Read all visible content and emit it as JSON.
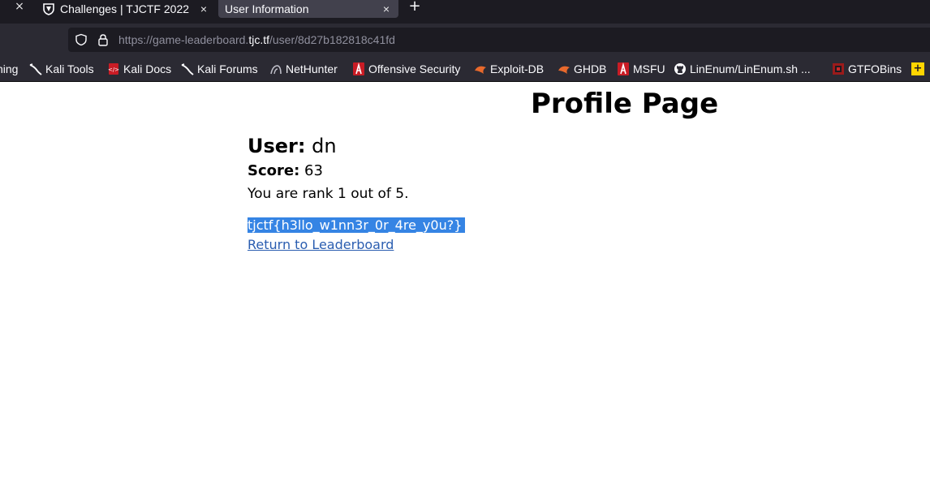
{
  "browser": {
    "tabs": [
      {
        "title": "Challenges | TJCTF 2022",
        "active": false,
        "icon": "tjctf-shield-icon"
      },
      {
        "title": "User Information",
        "active": true,
        "icon": ""
      }
    ],
    "close_symbol": "×",
    "new_tab_symbol": "+",
    "url": {
      "prefix": "https://game-leaderboard.",
      "host": "tjc.tf",
      "path": "/user/8d27b182818c41fd"
    },
    "bookmarks": [
      {
        "label": "ning",
        "icon": ""
      },
      {
        "label": "Kali Tools",
        "icon": "kali-dragon-icon"
      },
      {
        "label": "Kali Docs",
        "icon": "kali-docs-icon"
      },
      {
        "label": "Kali Forums",
        "icon": "kali-dragon-icon"
      },
      {
        "label": "NetHunter",
        "icon": "nethunter-icon"
      },
      {
        "label": "Offensive Security",
        "icon": "offsec-icon"
      },
      {
        "label": "Exploit-DB",
        "icon": "exploitdb-icon"
      },
      {
        "label": "GHDB",
        "icon": "exploitdb-icon"
      },
      {
        "label": "MSFU",
        "icon": "offsec-icon"
      },
      {
        "label": "LinEnum/LinEnum.sh ...",
        "icon": "github-icon"
      },
      {
        "label": "GTFOBins",
        "icon": "gtfobins-icon"
      }
    ],
    "overflow_symbol": "+"
  },
  "page": {
    "title": "Profile Page",
    "user_label": "User:",
    "user_value": "dn",
    "score_label": "Score:",
    "score_value": "63",
    "rank_text": "You are rank 1 out of 5.",
    "flag_text": "tjctf{h3llo_w1nn3r_0r_4re_y0u?}",
    "return_link": "Return to Leaderboard"
  },
  "colors": {
    "tabstrip_bg": "#1c1b22",
    "toolbar_bg": "#2b2a33",
    "active_tab_bg": "#42414d",
    "selection_bg": "#3584e4",
    "link": "#2a5db0"
  }
}
